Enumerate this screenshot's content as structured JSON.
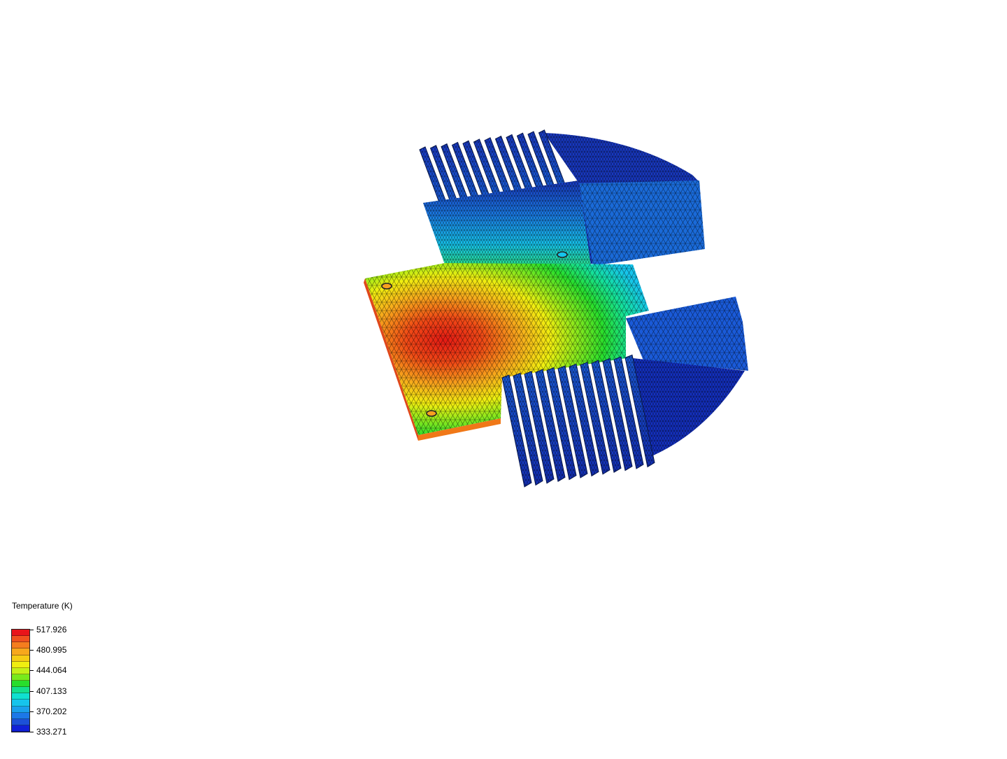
{
  "legend": {
    "title": "Temperature (K)",
    "ticks": [
      "517.926",
      "480.995",
      "444.064",
      "407.133",
      "370.202",
      "333.271"
    ],
    "colors": [
      "#e8141a",
      "#f0501e",
      "#f57d1e",
      "#f7a81c",
      "#f6cc14",
      "#f0ee10",
      "#c4f018",
      "#78ea1c",
      "#28de2c",
      "#14e08c",
      "#10e0d0",
      "#16c4ec",
      "#1aa0ec",
      "#1c78e8",
      "#1c50d8",
      "#1020d8"
    ]
  },
  "model": {
    "description_colors": {
      "hot": "#e8141a",
      "warm": "#f7a81c",
      "mid": "#28de2c",
      "cool": "#16c4ec",
      "cold": "#1028c8"
    }
  }
}
